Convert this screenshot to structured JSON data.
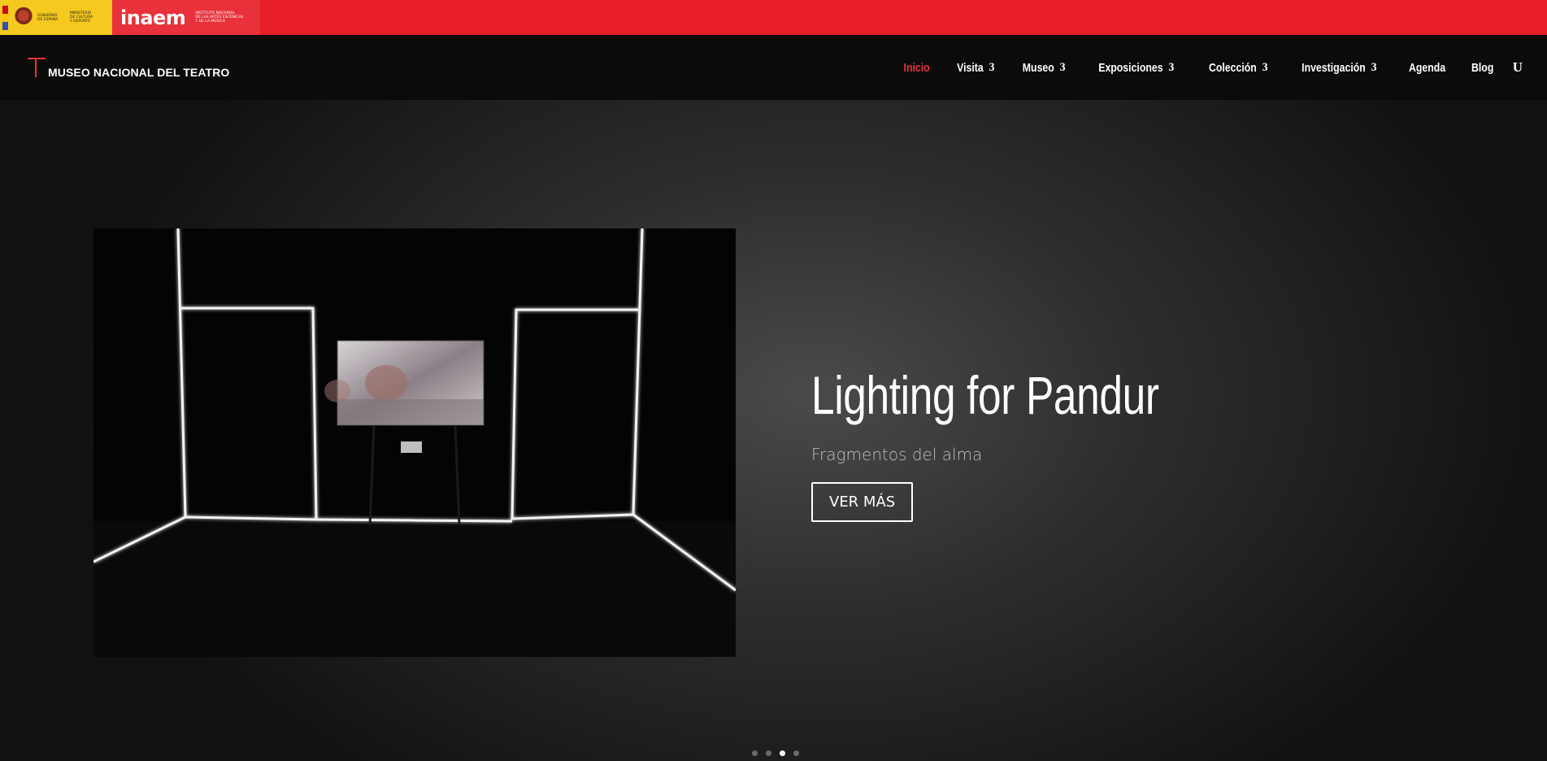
{
  "gov_bar": {
    "gobierno_text": "GOBIERNO\nDE ESPAÑA",
    "ministerio_text": "MINISTERIO\nDE CULTURA\nY DEPORTE",
    "inaem_brand": "inaem",
    "inaem_text": "INSTITUTO NACIONAL\nDE LAS ARTES ESCÉNICAS\nY DE LA MÚSICA",
    "color": "#e81f29"
  },
  "header": {
    "site_name": "MUSEO NACIONAL DEL TEATRO",
    "nav": [
      {
        "label": "Inicio",
        "active": true,
        "has_submenu": false
      },
      {
        "label": "Visita",
        "active": false,
        "has_submenu": true
      },
      {
        "label": "Museo",
        "active": false,
        "has_submenu": true
      },
      {
        "label": "Exposiciones",
        "active": false,
        "has_submenu": true
      },
      {
        "label": "Colección",
        "active": false,
        "has_submenu": true
      },
      {
        "label": "Investigación",
        "active": false,
        "has_submenu": true
      },
      {
        "label": "Agenda",
        "active": false,
        "has_submenu": false
      },
      {
        "label": "Blog",
        "active": false,
        "has_submenu": false
      }
    ],
    "submenu_glyph": "3",
    "search_glyph": "U",
    "accent_color": "#e8313a"
  },
  "hero": {
    "title": "Lighting for Pandur",
    "subtitle": "Fragmentos del alma",
    "button_label": "VER MÁS",
    "slides_total": 4,
    "active_slide": 3
  }
}
